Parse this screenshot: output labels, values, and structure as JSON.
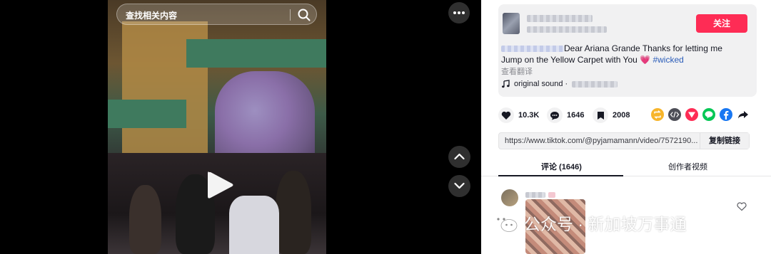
{
  "search": {
    "placeholder": "查找相关内容"
  },
  "post": {
    "follow_label": "关注",
    "description_text": "Dear Ariana Grande Thanks for letting me Jump on the Yellow Carpet with You",
    "heart_emoji": "💗",
    "hashtag": "#wicked",
    "translate_label": "查看翻译",
    "sound_label": "original sound ·"
  },
  "stats": {
    "likes": "10.3K",
    "comments": "1646",
    "saves": "2008"
  },
  "share": {
    "icons": [
      "repost-icon",
      "embed-icon",
      "send-icon",
      "line-icon",
      "facebook-icon",
      "share-arrow-icon"
    ]
  },
  "link": {
    "url": "https://www.tiktok.com/@pyjamamann/video/7572190...",
    "copy_label": "复制链接"
  },
  "tabs": {
    "comments_label": "评论 (1646)",
    "creator_videos_label": "创作者视频"
  },
  "watermark": {
    "text": "公众号 · 新加坡万事通"
  },
  "colors": {
    "accent": "#fe2c55",
    "hashtag": "#2b5db9",
    "panel_bg": "#ffffff",
    "card_bg": "#f1f1f2"
  }
}
